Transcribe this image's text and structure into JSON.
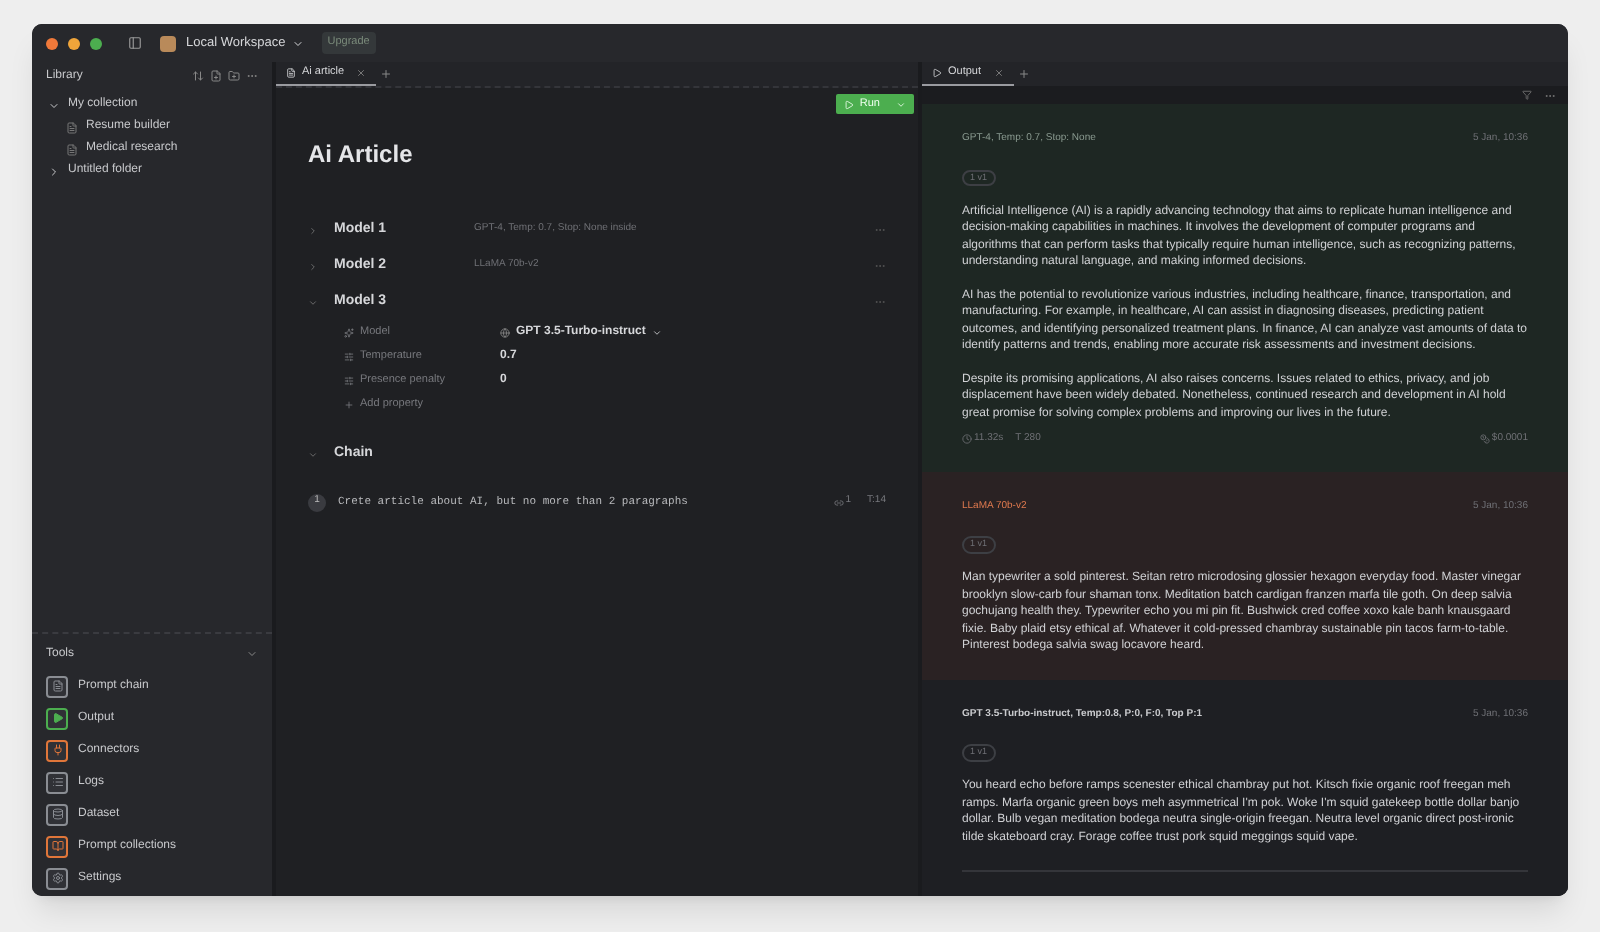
{
  "window": {
    "workspace": "Local Workspace",
    "upgrade": "Upgrade"
  },
  "sidebar": {
    "title": "Library",
    "tree": [
      {
        "label": "My collection",
        "expanded": true,
        "children": [
          {
            "label": "Resume builder"
          },
          {
            "label": "Medical research"
          }
        ]
      },
      {
        "label": "Untitled folder",
        "expanded": false
      }
    ],
    "tools_title": "Tools",
    "tools": [
      {
        "label": "Prompt chain",
        "kind": "chain",
        "color": "#8a8d93"
      },
      {
        "label": "Output",
        "kind": "output",
        "color": "#4cae4f"
      },
      {
        "label": "Connectors",
        "kind": "connectors",
        "color": "#e0763a"
      },
      {
        "label": "Logs",
        "kind": "logs",
        "color": "#8a8d93"
      },
      {
        "label": "Dataset",
        "kind": "dataset",
        "color": "#8a8d93"
      },
      {
        "label": "Prompt collections",
        "kind": "collections",
        "color": "#e0763a"
      },
      {
        "label": "Settings",
        "kind": "settings",
        "color": "#8a8d93"
      }
    ]
  },
  "editor": {
    "tabs": [
      {
        "label": "Ai article",
        "selected": true
      }
    ],
    "run_button": "Run",
    "title": "Ai Article",
    "models": [
      {
        "name": "Model 1",
        "summary": "GPT-4, Temp: 0.7, Stop: None inside",
        "expanded": false
      },
      {
        "name": "Model 2",
        "summary": "LLaMA 70b-v2",
        "expanded": false
      },
      {
        "name": "Model 3",
        "expanded": true,
        "properties": [
          {
            "label": "Model",
            "value": "GPT 3.5-Turbo-instruct",
            "kind": "select"
          },
          {
            "label": "Temperature",
            "value": "0.7",
            "kind": "number"
          },
          {
            "label": "Presence penalty",
            "value": "0",
            "kind": "number"
          }
        ],
        "add_property": "Add property"
      }
    ],
    "chain": {
      "title": "Chain",
      "expanded": true,
      "steps": [
        {
          "number": "1",
          "text": "Crete article about AI, but no more than 2 paragraphs",
          "links": "1",
          "tokens": "T:14"
        }
      ]
    }
  },
  "output": {
    "tabs": [
      {
        "label": "Output",
        "selected": true
      }
    ],
    "results": [
      {
        "kind": "success",
        "header": "GPT-4, Temp: 0.7, Stop: None",
        "time": "5 Jan, 10:36",
        "version": "1 v1",
        "paragraphs": [
          "Artificial Intelligence (AI) is a rapidly advancing technology that aims to replicate human intelligence and decision-making capabilities in machines. It involves the development of computer programs and algorithms that can perform tasks that typically require human intelligence, such as recognizing patterns, understanding natural language, and making informed decisions.",
          "AI has the potential to revolutionize various industries, including healthcare, finance, transportation, and manufacturing. For example, in healthcare, AI can assist in diagnosing diseases, predicting patient outcomes, and identifying personalized treatment plans. In finance, AI can analyze vast amounts of data to identify patterns and trends, enabling more accurate risk assessments and investment decisions.",
          "Despite its promising applications, AI also raises concerns. Issues related to ethics, privacy, and job displacement have been widely debated. Nonetheless, continued research and development in AI hold great promise for solving complex problems and improving our lives in the future."
        ],
        "duration": "11.32s",
        "tokens": "T 280",
        "cost": "$0.0001"
      },
      {
        "kind": "error",
        "header": "LLaMA 70b-v2",
        "time": "5 Jan, 10:36",
        "version": "1 v1",
        "paragraphs": [
          "Man typewriter a sold pinterest. Seitan retro microdosing glossier hexagon everyday food. Master vinegar brooklyn slow-carb four shaman tonx. Meditation batch cardigan franzen marfa tile goth. On deep salvia gochujang health they. Typewriter echo you mi pin fit. Bushwick cred coffee xoxo kale banh knausgaard fixie. Baby plaid etsy ethical af. Whatever it cold-pressed chambray sustainable pin tacos farm-to-table. Pinterest bodega salvia swag locavore heard."
        ]
      },
      {
        "kind": "neutral",
        "header": "GPT 3.5-Turbo-instruct, Temp:0.8, P:0, F:0, Top P:1",
        "time": "5 Jan, 10:36",
        "version": "1 v1",
        "paragraphs": [
          "You heard echo before ramps scenester ethical chambray put hot. Kitsch fixie organic roof freegan meh ramps. Marfa organic green boys meh asymmetrical I'm pok. Woke I'm squid gatekeep bottle dollar banjo dollar. Bulb vegan meditation bodega neutra single-origin freegan. Neutra level organic direct post-ironic tilde skateboard cray. Forage coffee trust pork squid meggings squid vape."
        ]
      }
    ]
  }
}
